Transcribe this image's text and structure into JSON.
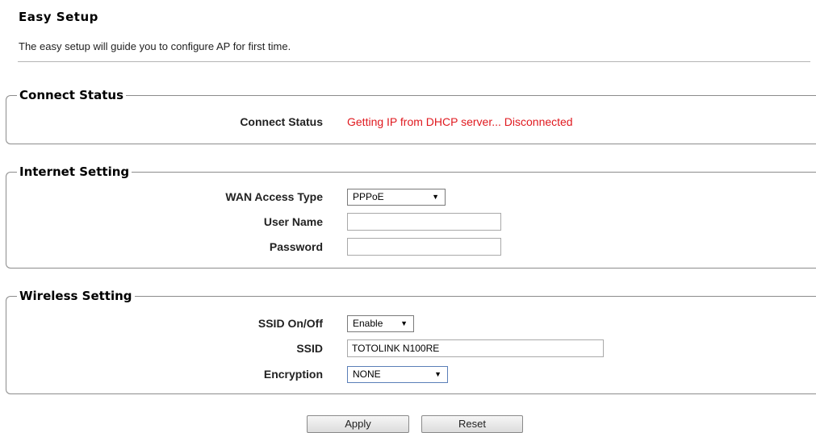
{
  "page": {
    "title": "Easy Setup",
    "description": "The easy setup will guide you to configure AP for first time."
  },
  "connect_status": {
    "legend": "Connect Status",
    "label": "Connect Status",
    "value": "Getting IP from DHCP server... Disconnected",
    "value_color": "#e0191f"
  },
  "internet": {
    "legend": "Internet Setting",
    "wan_label": "WAN Access Type",
    "wan_value": "PPPoE",
    "user_label": "User Name",
    "user_value": "",
    "password_label": "Password",
    "password_value": ""
  },
  "wireless": {
    "legend": "Wireless Setting",
    "ssid_onoff_label": "SSID On/Off",
    "ssid_onoff_value": "Enable",
    "ssid_label": "SSID",
    "ssid_value": "TOTOLINK N100RE",
    "encryption_label": "Encryption",
    "encryption_value": "NONE"
  },
  "buttons": {
    "apply": "Apply",
    "reset": "Reset"
  }
}
